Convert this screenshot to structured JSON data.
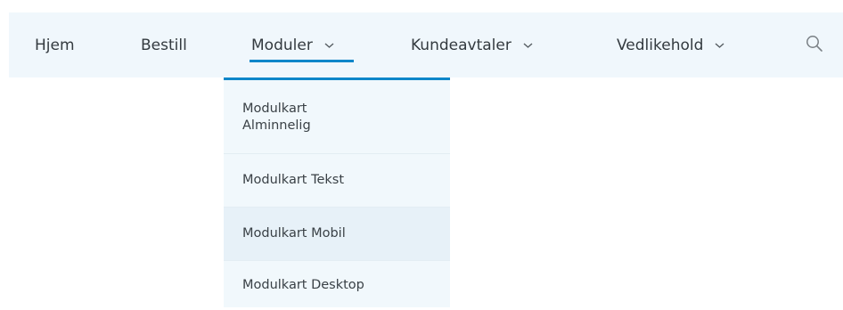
{
  "nav": {
    "items": [
      {
        "label": "Hjem",
        "has_dropdown": false
      },
      {
        "label": "Bestill",
        "has_dropdown": false
      },
      {
        "label": "Moduler",
        "has_dropdown": true,
        "active": true
      },
      {
        "label": "Kundeavtaler",
        "has_dropdown": true
      },
      {
        "label": "Vedlikehold",
        "has_dropdown": true
      }
    ],
    "search_icon": "search-icon"
  },
  "dropdown": {
    "items": [
      {
        "label": "Modulkart Alminnelig"
      },
      {
        "label": "Modulkart Tekst"
      },
      {
        "label": "Modulkart Mobil",
        "hovered": true
      },
      {
        "label": "Modulkart Desktop"
      }
    ]
  },
  "colors": {
    "accent": "#0d86c9",
    "nav_background": "#f0f7fc",
    "dropdown_background": "#f1f8fc",
    "dropdown_hover": "#e7f1f8",
    "text": "#333a3f"
  }
}
